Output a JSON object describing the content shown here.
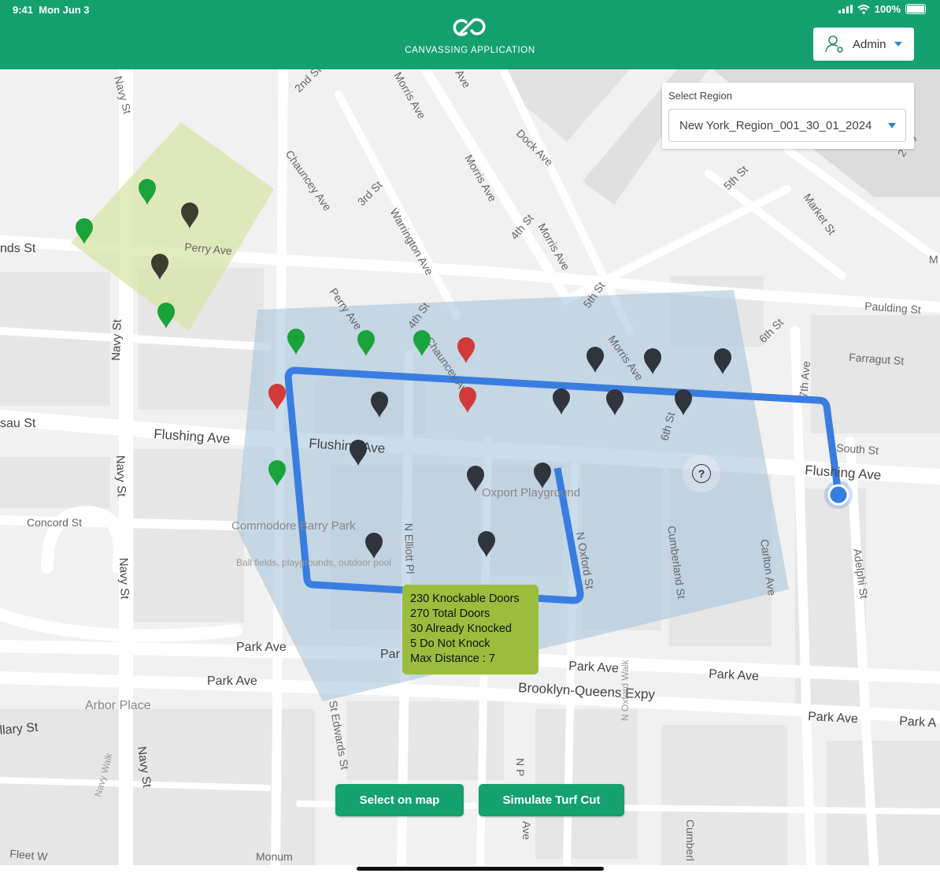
{
  "status_bar": {
    "time": "9:41",
    "date": "Mon Jun 3",
    "battery": "100%"
  },
  "header": {
    "app_title": "CANVASSING APPLICATION",
    "user_label": "Admin"
  },
  "region_selector": {
    "label": "Select Region",
    "value": "New York_Region_001_30_01_2024"
  },
  "turf_stats": [
    "230 Knockable Doors",
    "270 Total Doors",
    "30 Already Knocked",
    "5 Do Not Knock",
    "Max Distance : 7"
  ],
  "buttons": {
    "select_on_map": "Select on map",
    "simulate_turf_cut": "Simulate Turf Cut"
  },
  "map_labels": {
    "navy_st": "Navy St",
    "second_st": "2nd St",
    "morris_ave": "Morris Ave",
    "ave": "Ave",
    "chauncey_ave": "Chauncey Ave",
    "third_st": "3rd St",
    "warrington_ave": "Warrington Ave",
    "dock_ave": "Dock Ave",
    "fourth_st": "4th St",
    "fifth_st": "5th St",
    "sixth_st": "6th St",
    "market_st": "Market St",
    "perry_ave": "Perry Ave",
    "sands_st": "nds St",
    "paulding_st": "Paulding St",
    "farragut_st": "Farragut St",
    "seventh_ave": "7th Ave",
    "south_st": "South St",
    "flushing_ave": "Flushing Ave",
    "nassau_st": "sau St",
    "concord_st": "Concord St",
    "commodore_park": "Commodore Barry Park",
    "park_sub": "Ball fields, playgrounds, outdoor pool",
    "n_elliott_pl": "N Elliott Pl",
    "oxport_playground": "Oxport Playground",
    "n_oxford_st": "N Oxford St",
    "cumberland_st": "Cumberland St",
    "carlton_ave": "Carlton Ave",
    "adelphi_st": "Adelphi St",
    "park_ave": "Park Ave",
    "par": "Par",
    "bqe": "Brooklyn-Queens Expy",
    "arbor_place": "Arbor Place",
    "hillary_st": "llary St",
    "st_edwards_st": "St Edwards St",
    "navy_walk": "Navy Walk",
    "oxford_walk": "N Oxford Walk",
    "n_p": "N P",
    "cumberl": "Cumberl",
    "park_a": "Park A",
    "fleet": "Fleet W",
    "monu": "Monum",
    "wy": "2 Wy",
    "m": "M",
    "fifth_st_top": "5th St"
  },
  "colors": {
    "primary": "#14a06f",
    "route": "#3a7de0",
    "turf_fill": "#a8c4dc",
    "zone_fill": "#d8e4a8",
    "pin_green": "#1aa33a",
    "pin_red": "#d23a3a",
    "pin_dark": "#2f353b",
    "pin_olive": "#3c3f2f",
    "stats_bg": "#9bbd3e"
  }
}
